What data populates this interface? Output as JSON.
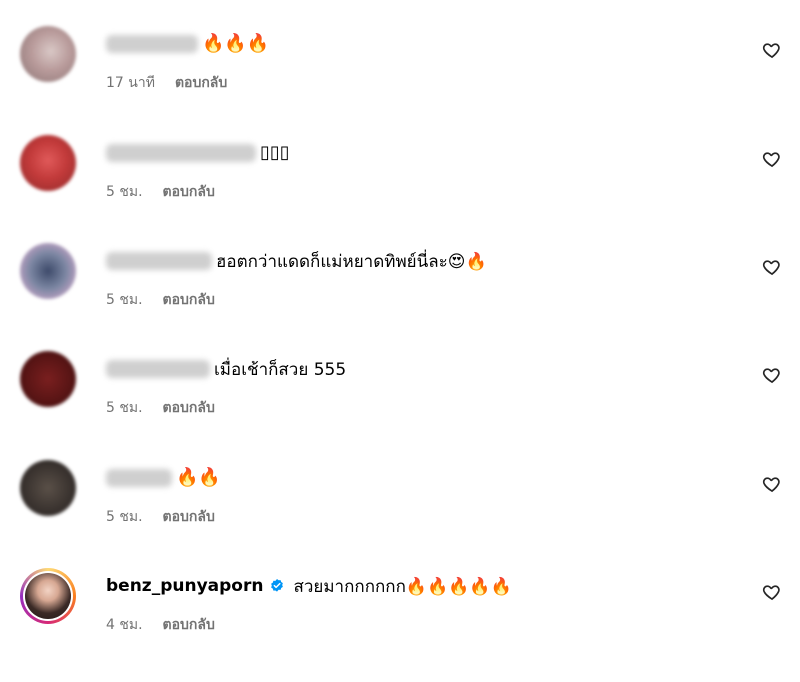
{
  "comments": [
    {
      "text": "🔥🔥🔥",
      "time": "17 นาที",
      "reply": "ตอบกลับ"
    },
    {
      "text": "▯▯▯",
      "time": "5 ชม.",
      "reply": "ตอบกลับ"
    },
    {
      "text": "ฮอตกว่าแดดก็แม่หยาดทิพย์นี่ละ😍🔥",
      "time": "5 ชม.",
      "reply": "ตอบกลับ"
    },
    {
      "text": "เมื่อเช้าก็สวย 555",
      "time": "5 ชม.",
      "reply": "ตอบกลับ"
    },
    {
      "text": "🔥🔥",
      "time": "5 ชม.",
      "reply": "ตอบกลับ"
    },
    {
      "username": "benz_punyaporn",
      "text": "สวยมากกกกกก🔥🔥🔥🔥🔥",
      "time": "4 ชม.",
      "reply": "ตอบกลับ"
    }
  ],
  "icons": {
    "like": "heart-outline-icon",
    "verified": "verified-badge-icon"
  },
  "colors": {
    "meta": "#737373",
    "verified": "#0095f6"
  }
}
